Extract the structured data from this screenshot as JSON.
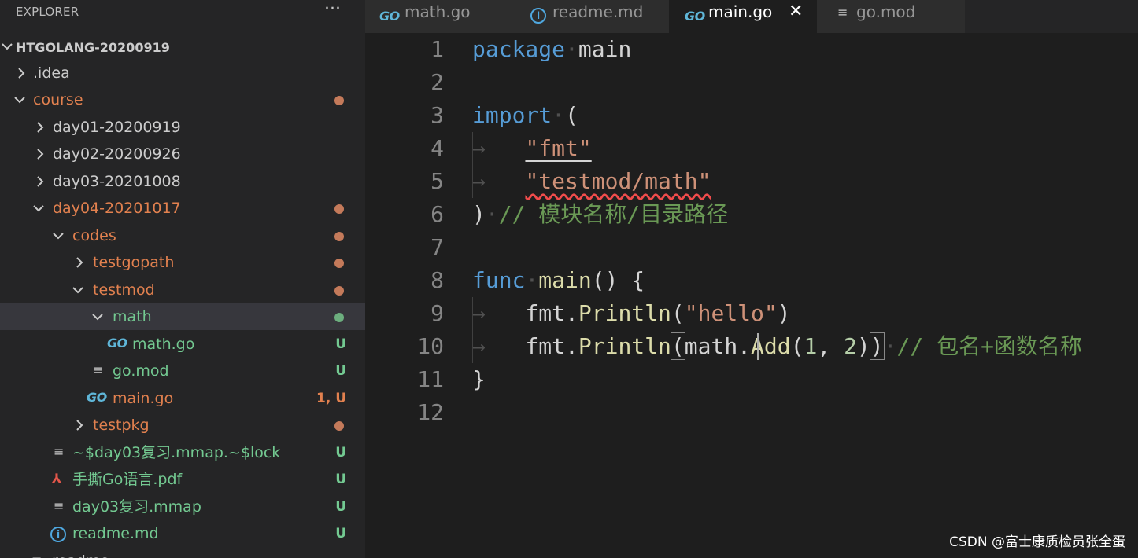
{
  "sidebar": {
    "title": "EXPLORER",
    "more": "···",
    "root": "HTGOLANG-20200919",
    "items": [
      {
        "label": ".idea",
        "badge": ""
      },
      {
        "label": "course",
        "badge": ""
      },
      {
        "label": "day01-20200919",
        "badge": ""
      },
      {
        "label": "day02-20200926",
        "badge": ""
      },
      {
        "label": "day03-20201008",
        "badge": ""
      },
      {
        "label": "day04-20201017",
        "badge": ""
      },
      {
        "label": "codes",
        "badge": ""
      },
      {
        "label": "testgopath",
        "badge": ""
      },
      {
        "label": "testmod",
        "badge": ""
      },
      {
        "label": "math",
        "badge": ""
      },
      {
        "label": "math.go",
        "badge": "U"
      },
      {
        "label": "go.mod",
        "badge": "U"
      },
      {
        "label": "main.go",
        "badge": "1, U"
      },
      {
        "label": "testpkg",
        "badge": ""
      },
      {
        "label": "~$day03复习.mmap.~$lock",
        "badge": "U"
      },
      {
        "label": "手撕Go语言.pdf",
        "badge": "U"
      },
      {
        "label": "day03复习.mmap",
        "badge": "U"
      },
      {
        "label": "readme.md",
        "badge": "U"
      },
      {
        "label": "readme",
        "badge": ""
      }
    ]
  },
  "tabs": [
    {
      "label": "math.go",
      "icon": "go-icon"
    },
    {
      "label": "readme.md",
      "icon": "info-icon"
    },
    {
      "label": "main.go",
      "icon": "go-icon",
      "active": true
    },
    {
      "label": "go.mod",
      "icon": "lines-icon"
    }
  ],
  "icons": {
    "go": "GO",
    "info": "i",
    "close": "✕",
    "lines": "≡",
    "pdf": "⅄"
  },
  "editor": {
    "line_numbers": [
      "1",
      "2",
      "3",
      "4",
      "5",
      "6",
      "7",
      "8",
      "9",
      "10",
      "11",
      "12"
    ],
    "code": {
      "l1_kw": "package",
      "l1_rest": "main",
      "l3_kw": "import",
      "l3_rest": "(",
      "l4_str": "\"fmt\"",
      "l5_str": "\"testmod/math\"",
      "l6_paren": ")",
      "l6_comment": "// 模块名称/目录路径",
      "l8_kw": "func",
      "l8_fn": "main",
      "l8_rest": "() {",
      "l9_pkg": "fmt.",
      "l9_fn": "Println",
      "l9_open": "(",
      "l9_str": "\"hello\"",
      "l9_close": ")",
      "l10_pkg": "fmt.",
      "l10_fn": "Println",
      "l10_open": "(",
      "l10_pkg2": "math.",
      "l10_fn2": "Add",
      "l10_args_open": "(",
      "l10_n1": "1",
      "l10_comma": ", ",
      "l10_n2": "2",
      "l10_args_close": ")",
      "l10_close": ")",
      "l10_comment": "// 包名+函数名称",
      "l11_brace": "}"
    }
  },
  "watermark": "CSDN @富士康质检员张全蛋",
  "colors": {
    "modified": "#e2814f",
    "untracked": "#73c991",
    "keyword": "#569cd6",
    "string": "#ce9178",
    "comment": "#6a9955",
    "function": "#dcdcaa",
    "number": "#b5cea8"
  }
}
